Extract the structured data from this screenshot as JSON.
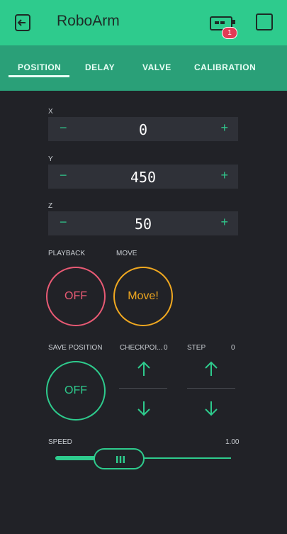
{
  "header": {
    "title": "RoboArm",
    "notification_count": "1"
  },
  "tabs": [
    {
      "label": "POSITION",
      "active": true
    },
    {
      "label": "DELAY"
    },
    {
      "label": "VALVE"
    },
    {
      "label": "CALIBRATION"
    }
  ],
  "controls": {
    "x": {
      "label": "X",
      "value": "0",
      "minus": "−",
      "plus": "+"
    },
    "y": {
      "label": "Y",
      "value": "450",
      "minus": "−",
      "plus": "+"
    },
    "z": {
      "label": "Z",
      "value": "50",
      "minus": "−",
      "plus": "+"
    },
    "playback": {
      "label": "PLAYBACK",
      "button": "OFF",
      "color": "#e85a74"
    },
    "move": {
      "label": "MOVE",
      "button": "Move!",
      "color": "#f0a820"
    },
    "save_position": {
      "label": "SAVE POSITION",
      "button": "OFF",
      "color": "#2ecb8d"
    },
    "checkpoint": {
      "label": "CHECKPOI...",
      "value": "0"
    },
    "step": {
      "label": "STEP",
      "value": "0"
    },
    "speed": {
      "label": "SPEED",
      "value": "1.00",
      "fraction": 0.28
    }
  },
  "colors": {
    "accent": "#2ecb8d",
    "tab_bg": "#2aa078",
    "background": "#212227"
  }
}
